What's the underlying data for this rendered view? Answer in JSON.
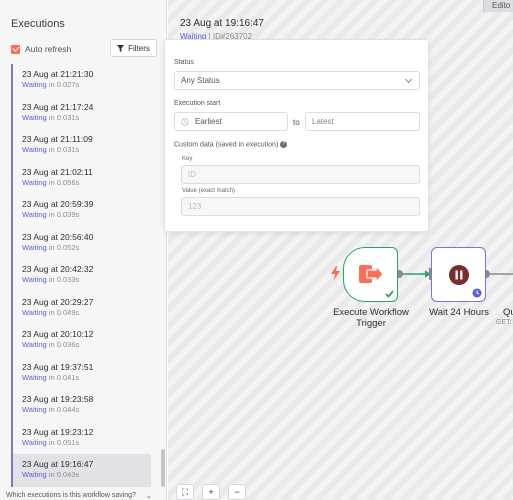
{
  "header": {
    "right_tab": "Edito"
  },
  "sidebar": {
    "title": "Executions",
    "auto_refresh_label": "Auto refresh",
    "filters_label": "Filters",
    "items": [
      {
        "date": "23 Aug at 21:21:30",
        "status": "Waiting",
        "duration": " in 0.027s"
      },
      {
        "date": "23 Aug at 21:17:24",
        "status": "Waiting",
        "duration": " in 0.031s"
      },
      {
        "date": "23 Aug at 21:11:09",
        "status": "Waiting",
        "duration": " in 0.031s"
      },
      {
        "date": "23 Aug at 21:02:11",
        "status": "Waiting",
        "duration": " in 0.056s"
      },
      {
        "date": "23 Aug at 20:59:39",
        "status": "Waiting",
        "duration": " in 0.039s"
      },
      {
        "date": "23 Aug at 20:56:40",
        "status": "Waiting",
        "duration": " in 0.052s"
      },
      {
        "date": "23 Aug at 20:42:32",
        "status": "Waiting",
        "duration": " in 0.033s"
      },
      {
        "date": "23 Aug at 20:29:27",
        "status": "Waiting",
        "duration": " in 0.049s"
      },
      {
        "date": "23 Aug at 20:10:12",
        "status": "Waiting",
        "duration": " in 0.036s"
      },
      {
        "date": "23 Aug at 19:37:51",
        "status": "Waiting",
        "duration": " in 0.041s"
      },
      {
        "date": "23 Aug at 19:23:58",
        "status": "Waiting",
        "duration": " in 0.044s"
      },
      {
        "date": "23 Aug at 19:23:12",
        "status": "Waiting",
        "duration": " in 0.051s"
      },
      {
        "date": "23 Aug at 19:16:47",
        "status": "Waiting",
        "duration": " in 0.043s"
      }
    ],
    "bottom_question": "Which executions is this workflow saving?",
    "bottom_chevron": "⌄"
  },
  "execution": {
    "date": "23 Aug at 19:16:47",
    "status": "Waiting",
    "id_text": " | ID#263702"
  },
  "filter_panel": {
    "status_label": "Status",
    "status_value": "Any Status",
    "start_label": "Execution start",
    "earliest_placeholder": "Earliest",
    "to_label": "to",
    "latest_placeholder": "Latest",
    "custom_label": "Custom data (saved in execution)",
    "help_glyph": "?",
    "key_label": "Key",
    "key_placeholder": "ID",
    "value_label": "Value (exact match)",
    "value_placeholder": "123"
  },
  "nodes": {
    "trigger_label": "Execute Workflow Trigger",
    "wait_label": "Wait 24 Hours",
    "partial_label": "Qu",
    "partial_sub": "GET:"
  },
  "canvas_controls": {
    "fit": "⛶",
    "zoom_in": "+",
    "zoom_out": "−"
  },
  "colors": {
    "accent": "#ff6d5a",
    "waiting": "#5b60d8",
    "success": "#29a26a",
    "wait_node": "#7d74d9"
  }
}
